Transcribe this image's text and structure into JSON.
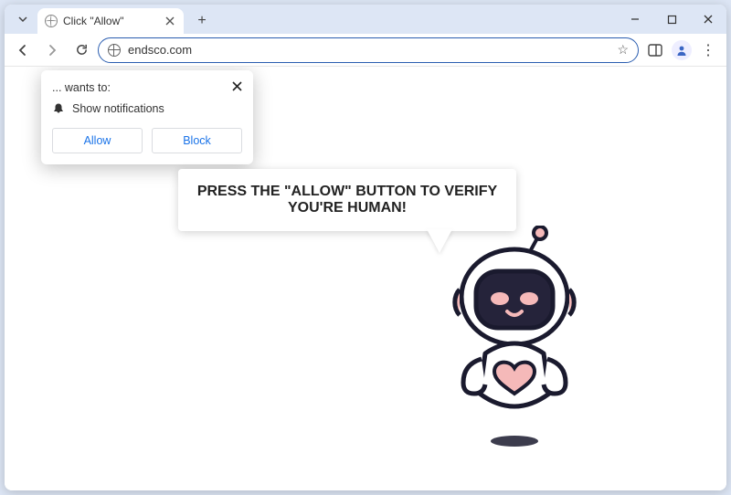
{
  "tab": {
    "title": "Click \"Allow\""
  },
  "omnibox": {
    "url": "endsco.com"
  },
  "notification": {
    "origin_text": "... wants to:",
    "permission_text": "Show notifications",
    "allow_label": "Allow",
    "block_label": "Block"
  },
  "page": {
    "speech_text": "PRESS THE \"ALLOW\" BUTTON TO VERIFY YOU'RE HUMAN!"
  }
}
